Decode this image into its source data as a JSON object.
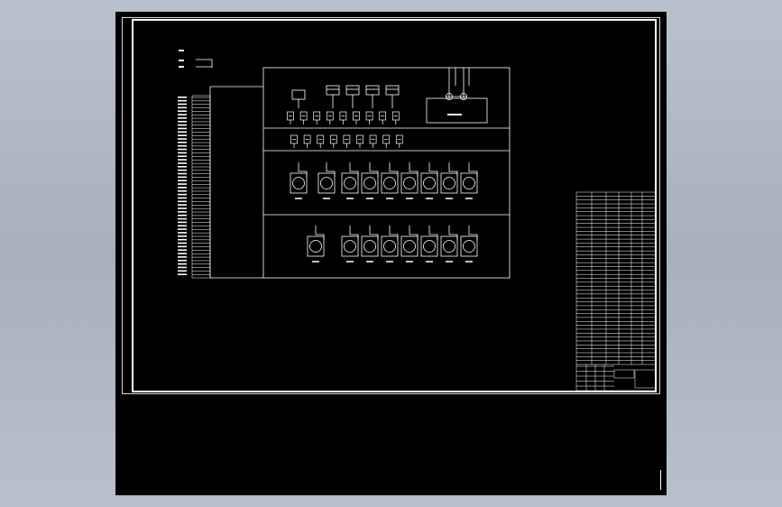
{
  "app": {
    "window_background": "#b3bcc7",
    "viewport_background": "#000000",
    "line_color": "#ffffff"
  },
  "drawing": {
    "type": "electrical control schematic (CAD sheet)",
    "top_breakers": 4,
    "upper_relay_row": 8,
    "lower_relay_row": 8,
    "module_row_1": 10,
    "module_row_2": 9,
    "terminal_rows": 52
  },
  "title_block": {
    "rows": 44,
    "columns": 6
  }
}
